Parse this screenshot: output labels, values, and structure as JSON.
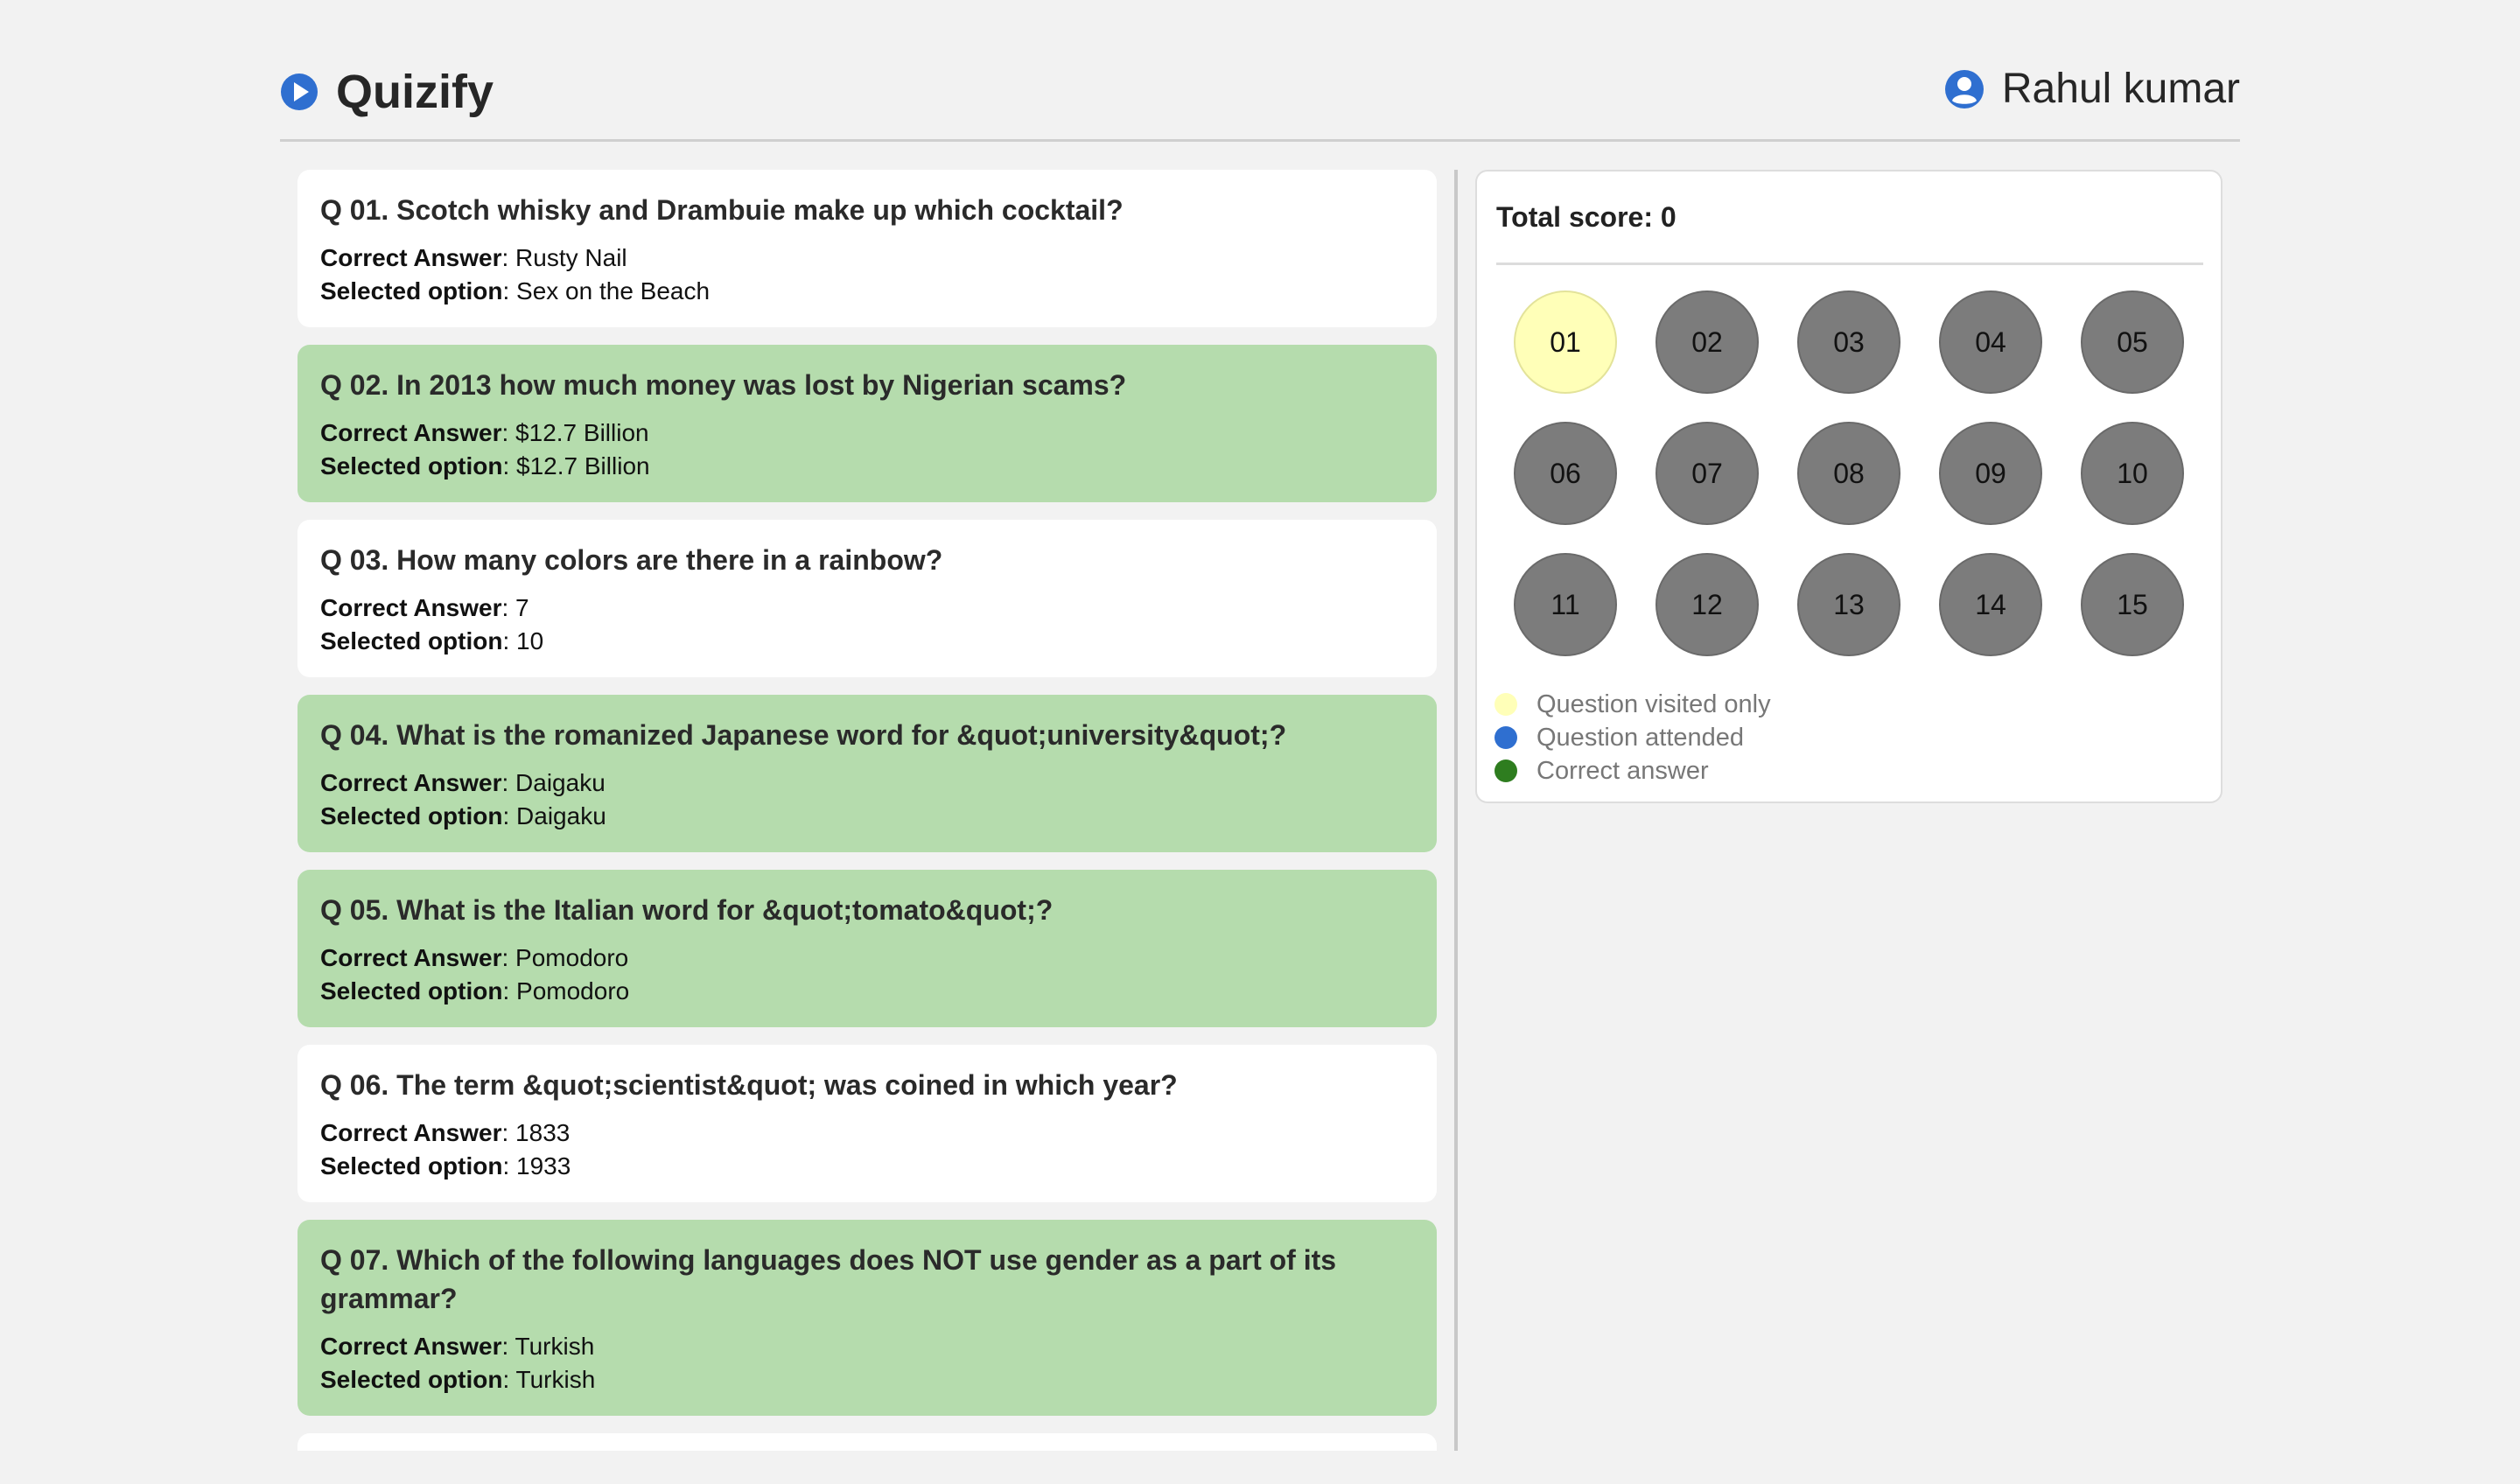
{
  "header": {
    "brand": "Quizify",
    "user": "Rahul kumar"
  },
  "questions": [
    {
      "title": "Q 01. Scotch whisky and Drambuie make up which cocktail?",
      "correct_label": "Correct Answer",
      "correct": "Rusty Nail",
      "selected_label": "Selected option",
      "selected": "Sex on the Beach",
      "is_correct": false
    },
    {
      "title": "Q 02. In 2013 how much money was lost by Nigerian scams?",
      "correct_label": "Correct Answer",
      "correct": "$12.7 Billion",
      "selected_label": "Selected option",
      "selected": "$12.7 Billion",
      "is_correct": true
    },
    {
      "title": "Q 03. How many colors are there in a rainbow?",
      "correct_label": "Correct Answer",
      "correct": "7",
      "selected_label": "Selected option",
      "selected": "10",
      "is_correct": false
    },
    {
      "title": "Q 04. What is the romanized Japanese word for &quot;university&quot;?",
      "correct_label": "Correct Answer",
      "correct": "Daigaku",
      "selected_label": "Selected option",
      "selected": "Daigaku",
      "is_correct": true
    },
    {
      "title": "Q 05. What is the Italian word for &quot;tomato&quot;?",
      "correct_label": "Correct Answer",
      "correct": "Pomodoro",
      "selected_label": "Selected option",
      "selected": "Pomodoro",
      "is_correct": true
    },
    {
      "title": "Q 06. The term &quot;scientist&quot; was coined in which year?",
      "correct_label": "Correct Answer",
      "correct": "1833",
      "selected_label": "Selected option",
      "selected": "1933",
      "is_correct": false
    },
    {
      "title": "Q 07. Which of the following languages does NOT use gender as a part of its grammar?",
      "correct_label": "Correct Answer",
      "correct": "Turkish",
      "selected_label": "Selected option",
      "selected": "Turkish",
      "is_correct": true
    }
  ],
  "panel": {
    "score": "Total score: 0",
    "buttons": [
      {
        "label": "01",
        "state": "visited"
      },
      {
        "label": "02",
        "state": "default"
      },
      {
        "label": "03",
        "state": "default"
      },
      {
        "label": "04",
        "state": "default"
      },
      {
        "label": "05",
        "state": "default"
      },
      {
        "label": "06",
        "state": "default"
      },
      {
        "label": "07",
        "state": "default"
      },
      {
        "label": "08",
        "state": "default"
      },
      {
        "label": "09",
        "state": "default"
      },
      {
        "label": "10",
        "state": "default"
      },
      {
        "label": "11",
        "state": "default"
      },
      {
        "label": "12",
        "state": "default"
      },
      {
        "label": "13",
        "state": "default"
      },
      {
        "label": "14",
        "state": "default"
      },
      {
        "label": "15",
        "state": "default"
      }
    ],
    "legend": [
      {
        "label": "Question visited only",
        "color": "#ffffb8"
      },
      {
        "label": "Question attended",
        "color": "#2f6fd0"
      },
      {
        "label": "Correct answer",
        "color": "#2e7d1f"
      }
    ]
  },
  "colors": {
    "brand_blue": "#2f6fd0",
    "correct_bg": "#b5dcad",
    "visited_bg": "#ffffb8",
    "button_gray": "#7c7c7c"
  }
}
